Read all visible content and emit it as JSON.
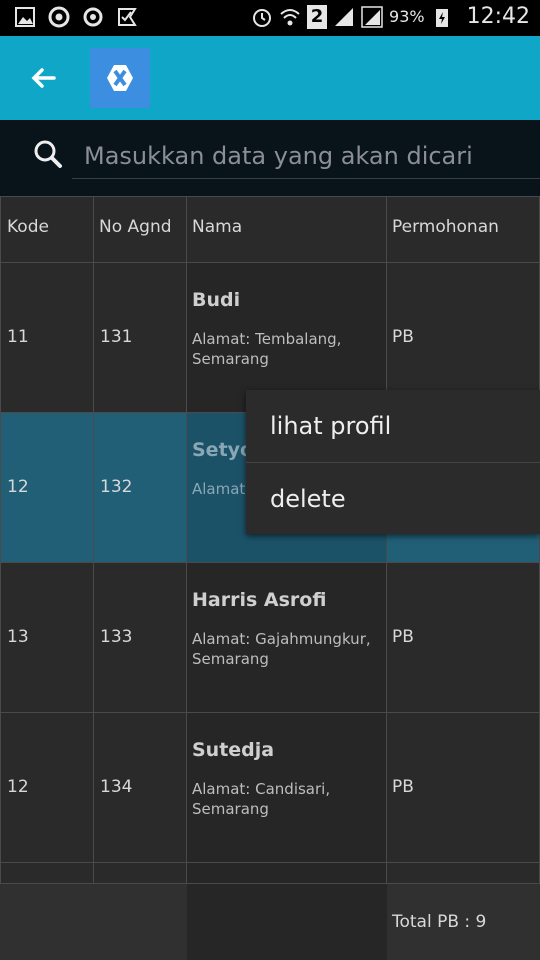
{
  "status_bar": {
    "battery_percent": "93%",
    "time": "12:42",
    "sim_badge": "2"
  },
  "search": {
    "placeholder": "Masukkan data yang akan dicari"
  },
  "table": {
    "columns": [
      "Kode",
      "No Agnd",
      "Nama",
      "Permohonan"
    ],
    "rows": [
      {
        "kode": "11",
        "no": "131",
        "nama": "Budi",
        "alamat": "Alamat: Tembalang, Semarang",
        "permohonan": "PB"
      },
      {
        "kode": "12",
        "no": "132",
        "nama": "Setyo",
        "alamat": "Alamat: Semarang",
        "permohonan": ""
      },
      {
        "kode": "13",
        "no": "133",
        "nama": "Harris Asrofi",
        "alamat": "Alamat: Gajahmungkur, Semarang",
        "permohonan": "PB"
      },
      {
        "kode": "12",
        "no": "134",
        "nama": "Sutedja",
        "alamat": "Alamat: Candisari, Semarang",
        "permohonan": "PB"
      }
    ],
    "total_label": "Total PB : 9"
  },
  "context_menu": {
    "items": [
      "lihat profil",
      "delete"
    ]
  },
  "colors": {
    "action_bar": "#10a6c7",
    "selected_row": "#215f77",
    "logo": "#3b8ee0"
  }
}
